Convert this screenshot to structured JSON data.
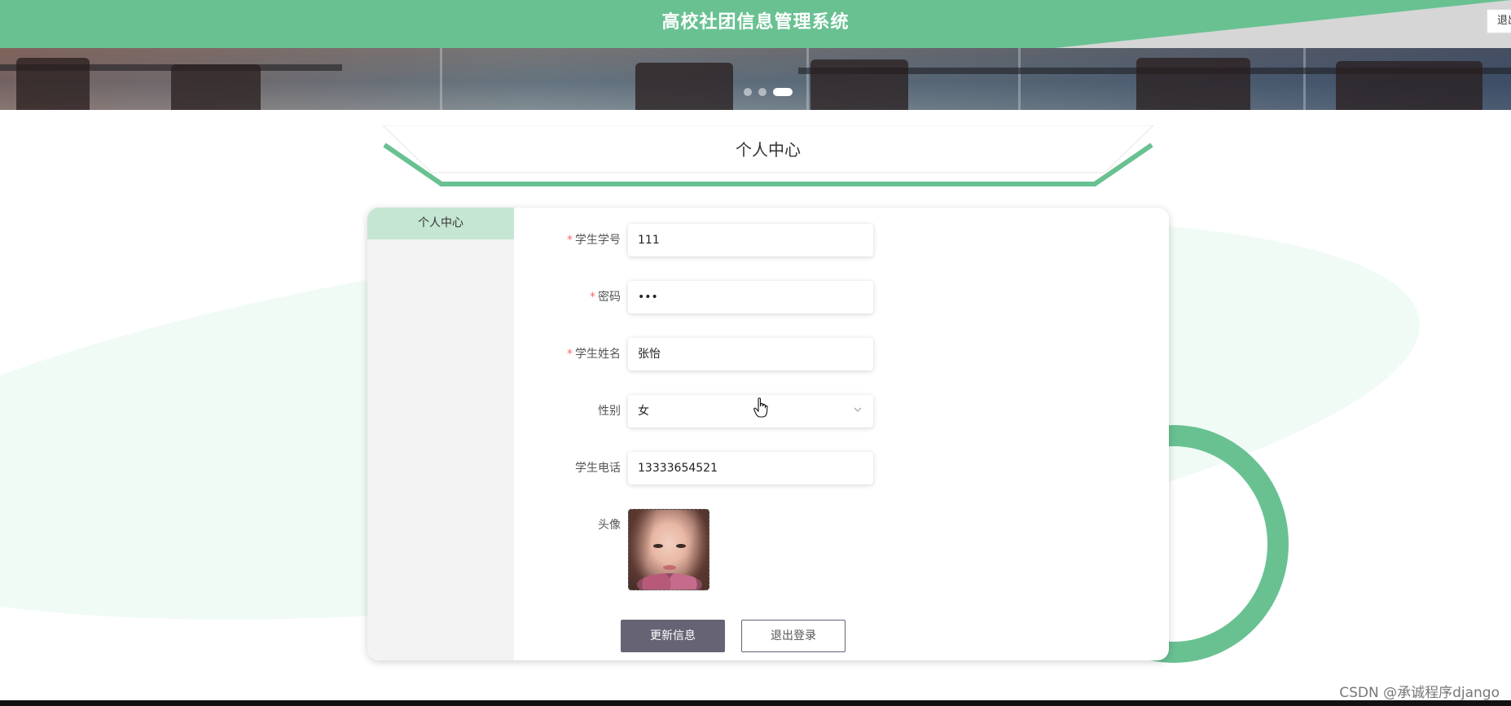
{
  "header": {
    "title": "高校社团信息管理系统",
    "logout_top": "退出"
  },
  "banner": {
    "active_slide": 3,
    "slide_count": 3
  },
  "section": {
    "title": "个人中心"
  },
  "sidebar": {
    "items": [
      {
        "label": "个人中心",
        "active": true
      }
    ]
  },
  "form": {
    "student_no": {
      "label": "学生学号",
      "required": true,
      "value": "111"
    },
    "password": {
      "label": "密码",
      "required": true,
      "value": "111"
    },
    "student_name": {
      "label": "学生姓名",
      "required": true,
      "value": "张怡"
    },
    "gender": {
      "label": "性别",
      "required": false,
      "value": "女"
    },
    "phone": {
      "label": "学生电话",
      "required": false,
      "value": "13333654521"
    },
    "avatar": {
      "label": "头像"
    }
  },
  "actions": {
    "update_label": "更新信息",
    "logout_label": "退出登录"
  },
  "watermark": "CSDN @承诚程序django",
  "colors": {
    "accent": "#69c192",
    "sidebar_active": "#c5e6d3",
    "button_dark": "#666474",
    "required_star": "#f56c6c"
  }
}
